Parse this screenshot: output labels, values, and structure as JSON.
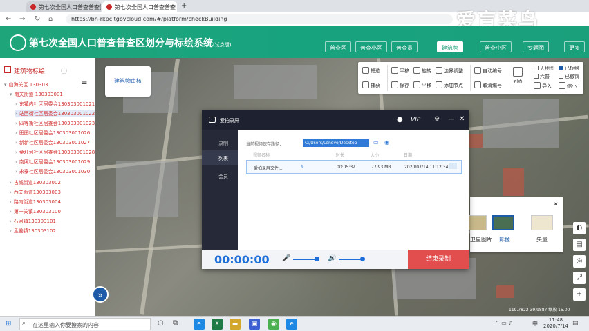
{
  "browser": {
    "tabs": [
      {
        "title": "第七次全国人口普查普查区"
      },
      {
        "title": "第七次全国人口普查普查"
      }
    ],
    "url": "https://bh-rkpc.tgovcloud.com/#/platform/checkBuilding",
    "watermark": "爱盲菜鸟"
  },
  "app": {
    "title": "第七次全国人口普查普查区划分与标绘系统",
    "title_suffix": "(试点版)",
    "nav": [
      "普查区",
      "普查小区",
      "普查员",
      "建筑物",
      "普查小区",
      "专题图",
      "更多"
    ],
    "active_nav_index": 3
  },
  "sidebar": {
    "title": "建筑物标绘",
    "tree": [
      {
        "label": "山海关区 130303",
        "level": 0,
        "arrow": "▾"
      },
      {
        "label": "南关街道 130303001",
        "level": 1,
        "arrow": "▾"
      },
      {
        "label": "东镇内社区居委会130303001021",
        "level": 2,
        "arrow": "›"
      },
      {
        "label": "站西街社区居委会130303001022",
        "level": 2,
        "arrow": "›",
        "selected": true
      },
      {
        "label": "四等街社区居委会130303001023",
        "level": 2,
        "arrow": "›"
      },
      {
        "label": "田园社区居委会130303001026",
        "level": 2,
        "arrow": "›"
      },
      {
        "label": "新新社区居委会130303001027",
        "level": 2,
        "arrow": "›"
      },
      {
        "label": "金圩河社区居委会130303001028",
        "level": 2,
        "arrow": "›"
      },
      {
        "label": "南照社区居委会130303001029",
        "level": 2,
        "arrow": "›"
      },
      {
        "label": "永泰社区居委会130303001030",
        "level": 2,
        "arrow": "›"
      },
      {
        "label": "古城街道130303002",
        "level": 1,
        "arrow": "›"
      },
      {
        "label": "西关街道130303003",
        "level": 1,
        "arrow": "›"
      },
      {
        "label": "路南街道130303004",
        "level": 1,
        "arrow": "›"
      },
      {
        "label": "第一关镇130303100",
        "level": 1,
        "arrow": "›"
      },
      {
        "label": "石河镇130303101",
        "level": 1,
        "arrow": "›"
      },
      {
        "label": "孟姜镇130303102",
        "level": 1,
        "arrow": "›"
      }
    ]
  },
  "map": {
    "label_card": "建筑物审核",
    "scale_info": "119.7822 39.9887 缩放 15.00"
  },
  "toolbar": {
    "items": [
      "框选",
      "捕获",
      "平移",
      "保存",
      "旋转",
      "平移",
      "边界调整",
      "添加节点",
      "自动编号",
      "取消编号",
      "列表"
    ],
    "layers": {
      "basemap": "天地图",
      "labeled": "已标绘",
      "six": "六普",
      "backup": "已撤销",
      "import": "导入",
      "zoom": "缩小"
    }
  },
  "layer_panel": {
    "items": [
      "卫星图片",
      "影像",
      "矢量"
    ]
  },
  "recorder": {
    "title": "爱拍录屏",
    "side": [
      "录制",
      "列表",
      "会员"
    ],
    "save_path_label": "当前视频保存路径：",
    "save_path": "C:/Users/Lenovo/Desktop",
    "col_heads": [
      "视频名称",
      "时长",
      "大小",
      "日期"
    ],
    "row": {
      "name": "爱拍录屏文件...",
      "duration": "00:05:32",
      "size": "77.93 MB",
      "date": "2020/07/14 11:12:34"
    },
    "timer": "00:00:00",
    "stop": "结束录制",
    "vip": "VIP"
  },
  "taskbar": {
    "search_placeholder": "在这里输入你要搜索的内容",
    "time": "11:48",
    "date": "2020/7/14",
    "lang": "中"
  }
}
